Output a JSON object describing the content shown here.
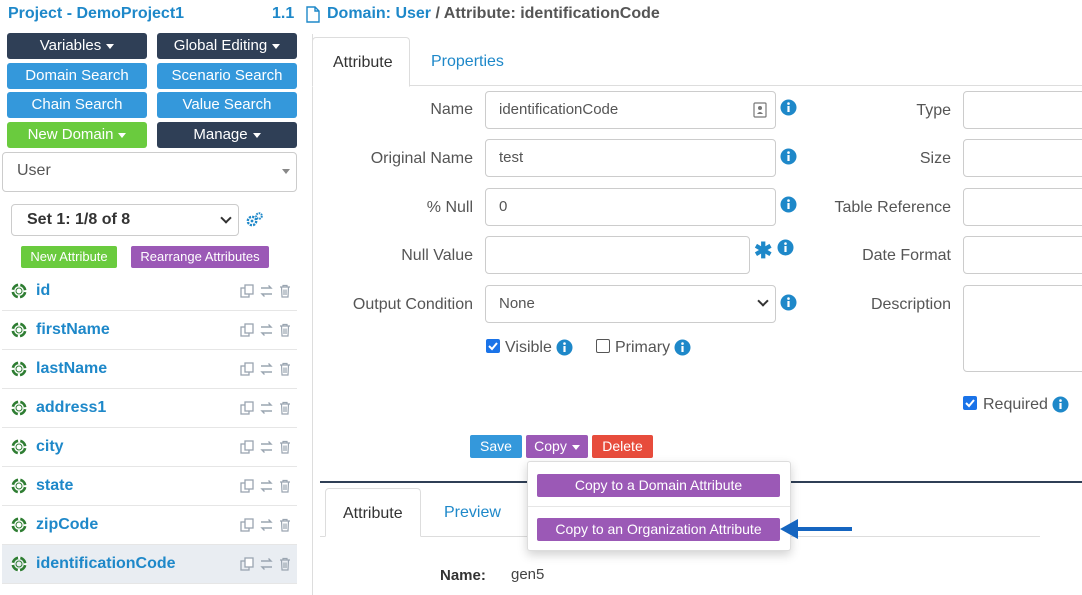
{
  "header": {
    "project_title": "Project - DemoProject1",
    "version": "1.1",
    "breadcrumb_domain": "Domain: User",
    "breadcrumb_sep": " / ",
    "breadcrumb_attribute": "Attribute: identificationCode"
  },
  "left_buttons": {
    "variables": "Variables",
    "global_editing": "Global Editing",
    "domain_search": "Domain Search",
    "scenario_search": "Scenario Search",
    "chain_search": "Chain Search",
    "value_search": "Value Search",
    "new_domain": "New Domain",
    "manage": "Manage"
  },
  "domain_select": {
    "value": "User"
  },
  "set_select": {
    "value": "Set 1: 1/8 of 8"
  },
  "list_actions": {
    "new_attribute": "New Attribute",
    "rearrange": "Rearrange Attributes"
  },
  "attributes": [
    {
      "name": "id"
    },
    {
      "name": "firstName"
    },
    {
      "name": "lastName"
    },
    {
      "name": "address1"
    },
    {
      "name": "city"
    },
    {
      "name": "state"
    },
    {
      "name": "zipCode"
    },
    {
      "name": "identificationCode",
      "selected": true
    }
  ],
  "tabs": {
    "attribute": "Attribute",
    "properties": "Properties"
  },
  "form": {
    "name_label": "Name",
    "name_value": "identificationCode",
    "original_name_label": "Original Name",
    "original_name_value": "test",
    "pct_null_label": "% Null",
    "pct_null_value": "0",
    "null_value_label": "Null Value",
    "null_value_value": "",
    "output_condition_label": "Output Condition",
    "output_condition_value": "None",
    "visible_label": "Visible",
    "visible_checked": true,
    "primary_label": "Primary",
    "primary_checked": false,
    "required_symbol": "✱"
  },
  "right_form": {
    "type_label": "Type",
    "size_label": "Size",
    "table_reference_label": "Table Reference",
    "date_format_label": "Date Format",
    "description_label": "Description",
    "required_label": "Required",
    "required_checked": true
  },
  "actions": {
    "save": "Save",
    "copy": "Copy",
    "delete": "Delete"
  },
  "copy_menu": {
    "to_domain": "Copy to a Domain Attribute",
    "to_org": "Copy to an Organization Attribute"
  },
  "lower_tabs": {
    "attribute": "Attribute",
    "preview": "Preview"
  },
  "preview": {
    "name_label": "Name:",
    "name_value": "gen5"
  },
  "colors": {
    "brand_blue": "#1e88c9",
    "dark": "#2f3f56",
    "button_blue": "#3498db",
    "green": "#6acb3e",
    "purple": "#9b59b6",
    "red": "#e74c3c"
  }
}
